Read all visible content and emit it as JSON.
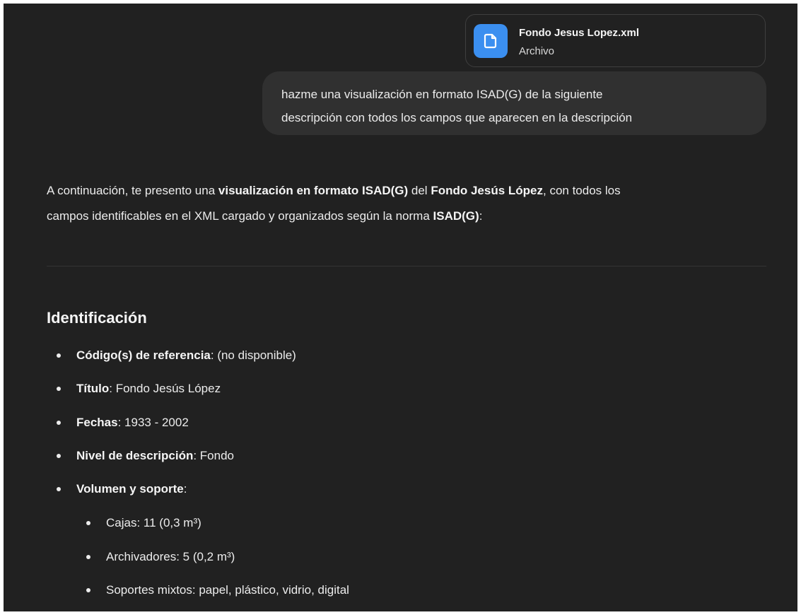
{
  "attachment": {
    "name": "Fondo Jesus Lopez.xml",
    "type": "Archivo",
    "icon": "document-icon",
    "icon_color": "#3b8ff0"
  },
  "user_message": {
    "line1": "hazme una visualización en formato ISAD(G) de la siguiente",
    "line2": "descripción con todos los campos que aparecen en la descripción"
  },
  "response": {
    "intro": {
      "p1": "A continuación, te presento una ",
      "b1": "visualización en formato ISAD(G)",
      "p2": " del ",
      "b2": "Fondo Jesús López",
      "p3": ", con todos los",
      "line2_p1": "campos identificables en el XML cargado y organizados según la norma ",
      "line2_b1": "ISAD(G)",
      "line2_p2": ":"
    },
    "section_title": "Identificación",
    "fields": [
      {
        "label": "Código(s) de referencia",
        "value": ": (no disponible)"
      },
      {
        "label": "Título",
        "value": ": Fondo Jesús López"
      },
      {
        "label": "Fechas",
        "value": ": 1933 - 2002"
      },
      {
        "label": "Nivel de descripción",
        "value": ": Fondo"
      },
      {
        "label": "Volumen y soporte",
        "value": ":"
      }
    ],
    "subfields": [
      "Cajas: 11 (0,3 m³)",
      "Archivadores: 5 (0,2 m³)",
      "Soportes mixtos: papel, plástico, vidrio, digital"
    ]
  },
  "colors": {
    "background": "#212121",
    "user_bubble": "#303030",
    "text": "#ececec"
  }
}
